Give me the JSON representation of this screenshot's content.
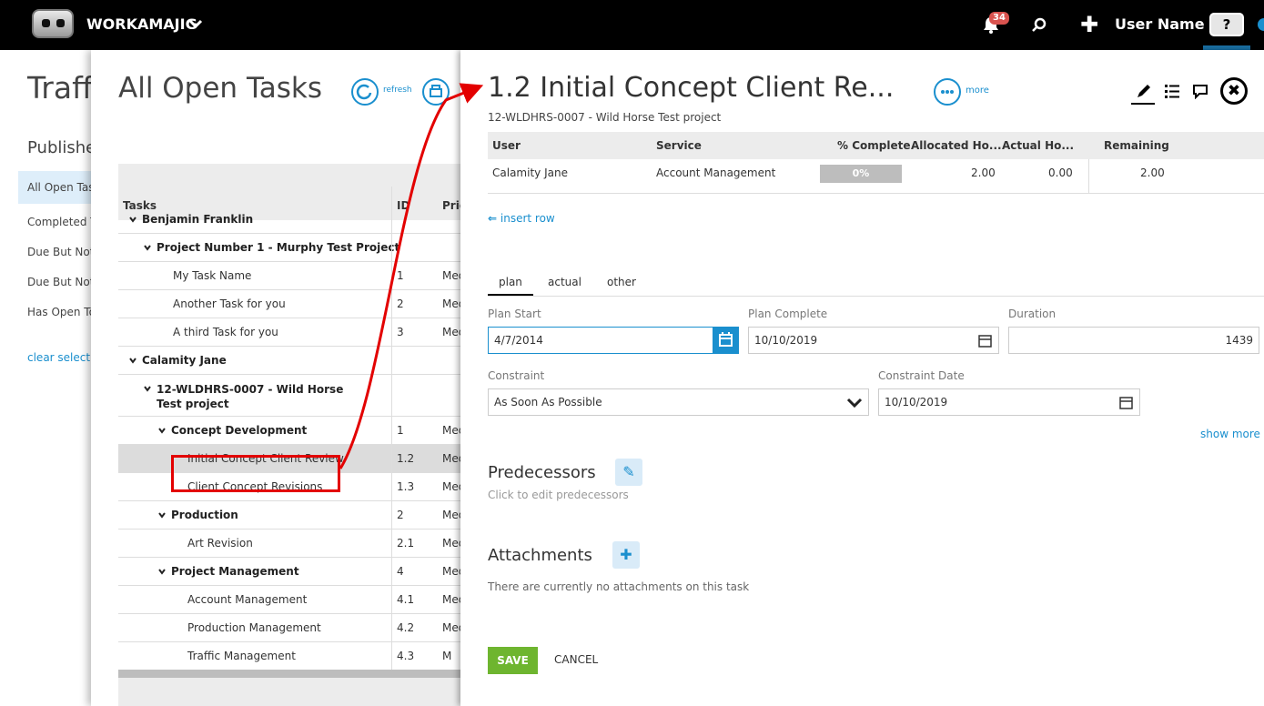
{
  "topbar": {
    "app_name": "WORKAMAJIG",
    "notification_count": "34",
    "user_name": "User Name",
    "help_label": "?",
    "icons": [
      "logo-icon",
      "chevron-down-icon",
      "bell-icon",
      "search-icon",
      "plus-icon",
      "help-icon"
    ]
  },
  "back_panel": {
    "title": "Traff",
    "published_heading": "Publishe",
    "items": [
      {
        "label": "All Open Tas",
        "active": true
      },
      {
        "label": "Completed T",
        "active": false
      },
      {
        "label": "Due But Not",
        "active": false
      },
      {
        "label": "Due But Not",
        "active": false
      },
      {
        "label": "Has Open To",
        "active": false
      }
    ],
    "clear_selection": "clear selecti"
  },
  "tasks_panel": {
    "title": "All Open Tasks",
    "refresh_label": "refresh",
    "columns": {
      "tasks": "Tasks",
      "id": "ID",
      "priority": "Prio"
    },
    "rows": [
      {
        "name": "Benjamin Franklin",
        "id": "",
        "pri": "",
        "level": 0,
        "group": true
      },
      {
        "name": "Project Number 1 - Murphy Test Project",
        "id": "",
        "pri": "",
        "level": 1,
        "group": true
      },
      {
        "name": "My Task Name",
        "id": "1",
        "pri": "Med",
        "level": 2,
        "group": false
      },
      {
        "name": "Another Task for you",
        "id": "2",
        "pri": "Med",
        "level": 2,
        "group": false
      },
      {
        "name": "A third Task for you",
        "id": "3",
        "pri": "Med",
        "level": 2,
        "group": false
      },
      {
        "name": "Calamity Jane",
        "id": "",
        "pri": "",
        "level": 0,
        "group": true
      },
      {
        "name": "12-WLDHRS-0007 - Wild Horse Test project",
        "id": "",
        "pri": "",
        "level": 1,
        "group": true
      },
      {
        "name": "Concept Development",
        "id": "1",
        "pri": "Med",
        "level": 2,
        "group": true
      },
      {
        "name": "Initial Concept Client Review",
        "id": "1.2",
        "pri": "Med",
        "level": 3,
        "group": false,
        "selected": true
      },
      {
        "name": "Client Concept Revisions",
        "id": "1.3",
        "pri": "Med",
        "level": 3,
        "group": false
      },
      {
        "name": "Production",
        "id": "2",
        "pri": "Med",
        "level": 2,
        "group": true
      },
      {
        "name": "Art Revision",
        "id": "2.1",
        "pri": "Med",
        "level": 3,
        "group": false
      },
      {
        "name": "Project Management",
        "id": "4",
        "pri": "Med",
        "level": 2,
        "group": true
      },
      {
        "name": "Account Management",
        "id": "4.1",
        "pri": "Med",
        "level": 3,
        "group": false
      },
      {
        "name": "Production Management",
        "id": "4.2",
        "pri": "Med",
        "level": 3,
        "group": false
      },
      {
        "name": "Traffic Management",
        "id": "4.3",
        "pri": "M",
        "level": 3,
        "group": false
      }
    ]
  },
  "detail": {
    "title": "1.2 Initial Concept Client Re...",
    "subtitle": "12-WLDHRS-0007 - Wild Horse Test project",
    "more_label": "more",
    "assignment_headers": {
      "user": "User",
      "service": "Service",
      "pct_complete": "% Complete",
      "allocated": "Allocated Ho...",
      "actual": "Actual Ho...",
      "remaining": "Remaining"
    },
    "assignment_row": {
      "user": "Calamity Jane",
      "service": "Account Management",
      "pct_complete": "0%",
      "pct_value": 0,
      "allocated": "2.00",
      "actual": "0.00",
      "remaining": "2.00"
    },
    "insert_row": "insert row",
    "tabs": {
      "plan": "plan",
      "actual": "actual",
      "other": "other"
    },
    "fields": {
      "plan_start_label": "Plan Start",
      "plan_start_value": "4/7/2014",
      "plan_complete_label": "Plan Complete",
      "plan_complete_value": "10/10/2019",
      "duration_label": "Duration",
      "duration_value": "1439",
      "constraint_label": "Constraint",
      "constraint_value": "As Soon As Possible",
      "constraint_date_label": "Constraint Date",
      "constraint_date_value": "10/10/2019"
    },
    "show_more": "show more",
    "predecessors": {
      "title": "Predecessors",
      "hint": "Click to edit predecessors"
    },
    "attachments": {
      "title": "Attachments",
      "hint": "There are currently no attachments on this task"
    },
    "save_label": "SAVE",
    "cancel_label": "CANCEL"
  },
  "colors": {
    "accent": "#1a8fce",
    "save": "#6eb52f",
    "annotation": "#e30000",
    "badge": "#d9534f"
  }
}
